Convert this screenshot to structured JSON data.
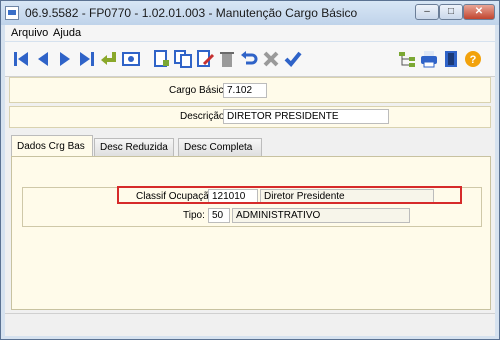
{
  "window": {
    "title": "06.9.5582 - FP0770 - 1.02.01.003 - Manutenção Cargo Básico"
  },
  "menu": {
    "arquivo": "Arquivo",
    "ajuda": "Ajuda"
  },
  "toolbar": {
    "icons": [
      "first-record-icon",
      "previous-record-icon",
      "next-record-icon",
      "last-record-icon",
      "return-icon",
      "view-icon",
      "new-record-icon",
      "copy-icon",
      "edit-icon",
      "delete-icon",
      "undo-icon",
      "cancel-icon",
      "confirm-icon",
      "tree-icon",
      "print-icon",
      "exit-icon",
      "help-icon"
    ],
    "accent": "#2f63c8"
  },
  "header": {
    "cargo_basico_label": "Cargo Básico:",
    "cargo_basico_value": "7.102",
    "descricao_label": "Descrição:",
    "descricao_value": "DIRETOR PRESIDENTE"
  },
  "tabs": [
    {
      "label": "Dados Crg Bas",
      "active": true
    },
    {
      "label": "Desc Reduzida",
      "active": false
    },
    {
      "label": "Desc Completa",
      "active": false
    }
  ],
  "dados": {
    "classif_label": "Classif Ocupação:",
    "classif_code": "121010",
    "classif_desc": "Diretor Presidente",
    "tipo_label": "Tipo:",
    "tipo_code": "50",
    "tipo_desc": "ADMINISTRATIVO"
  },
  "highlight_color": "#d62a2a"
}
